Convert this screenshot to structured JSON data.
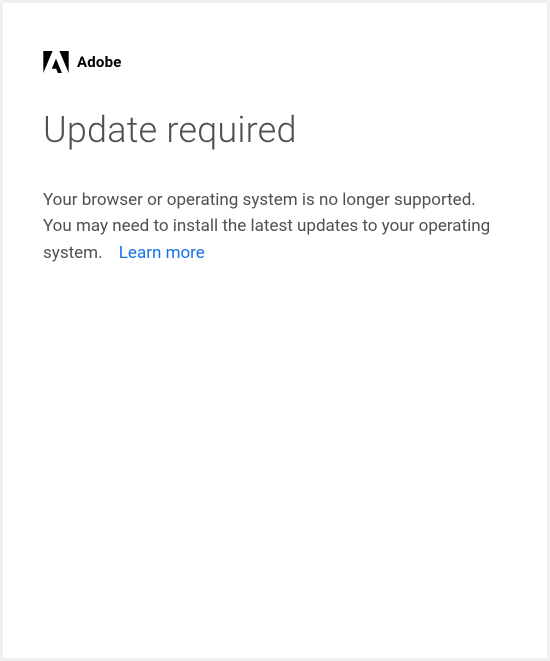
{
  "brand": {
    "name": "Adobe"
  },
  "page": {
    "title": "Update required",
    "message": "Your browser or operating system is no longer supported. You may need to install the latest updates to your operating system.",
    "learn_more_label": "Learn more"
  }
}
